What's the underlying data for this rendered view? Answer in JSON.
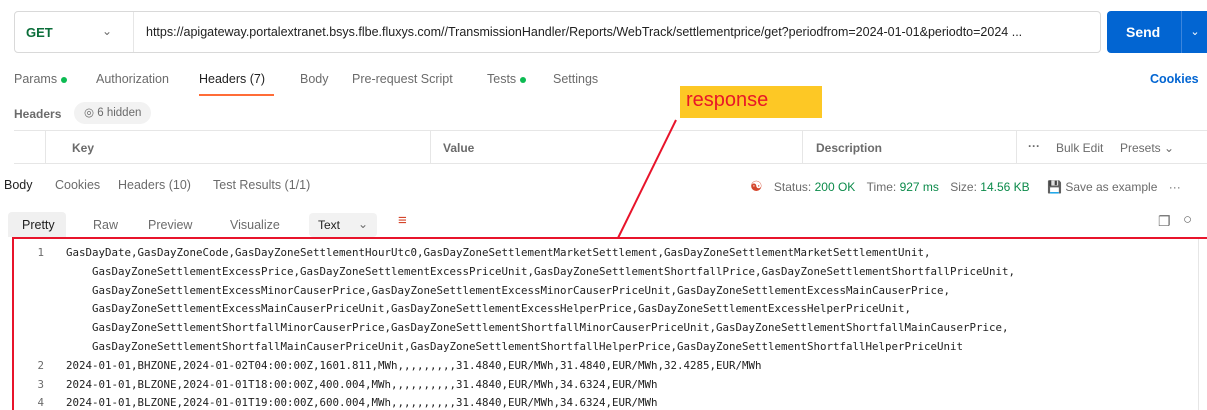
{
  "request": {
    "method": "GET",
    "url": "https://apigateway.portalextranet.bsys.flbe.fluxys.com//TransmissionHandler/Reports/WebTrack/settlementprice/get?periodfrom=2024-01-01&periodto=2024 ...",
    "send_label": "Send"
  },
  "request_tabs": [
    "Params",
    "Authorization",
    "Headers (7)",
    "Body",
    "Pre-request Script",
    "Tests",
    "Settings"
  ],
  "cookies_label": "Cookies",
  "headers_section": {
    "title": "Headers",
    "hidden": "6 hidden"
  },
  "table": {
    "col_key": "Key",
    "col_value": "Value",
    "col_description": "Description",
    "bulk_edit": "Bulk Edit",
    "presets": "Presets"
  },
  "response_tabs": [
    "Body",
    "Cookies",
    "Headers (10)",
    "Test Results (1/1)"
  ],
  "status": {
    "status_label": "Status:",
    "status_value": "200 OK",
    "time_label": "Time:",
    "time_value": "927 ms",
    "size_label": "Size:",
    "size_value": "14.56 KB",
    "save_example": "Save as example"
  },
  "view_tabs": [
    "Pretty",
    "Raw",
    "Preview",
    "Visualize"
  ],
  "format_select": "Text",
  "annotation": "response",
  "code_lines": [
    {
      "n": "1",
      "t": "GasDayDate,GasDayZoneCode,GasDayZoneSettlementHourUtc0,GasDayZoneSettlementMarketSettlement,GasDayZoneSettlementMarketSettlementUnit,"
    },
    {
      "n": "",
      "t": "    GasDayZoneSettlementExcessPrice,GasDayZoneSettlementExcessPriceUnit,GasDayZoneSettlementShortfallPrice,GasDayZoneSettlementShortfallPriceUnit,"
    },
    {
      "n": "",
      "t": "    GasDayZoneSettlementExcessMinorCauserPrice,GasDayZoneSettlementExcessMinorCauserPriceUnit,GasDayZoneSettlementExcessMainCauserPrice,"
    },
    {
      "n": "",
      "t": "    GasDayZoneSettlementExcessMainCauserPriceUnit,GasDayZoneSettlementExcessHelperPrice,GasDayZoneSettlementExcessHelperPriceUnit,"
    },
    {
      "n": "",
      "t": "    GasDayZoneSettlementShortfallMinorCauserPrice,GasDayZoneSettlementShortfallMinorCauserPriceUnit,GasDayZoneSettlementShortfallMainCauserPrice,"
    },
    {
      "n": "",
      "t": "    GasDayZoneSettlementShortfallMainCauserPriceUnit,GasDayZoneSettlementShortfallHelperPrice,GasDayZoneSettlementShortfallHelperPriceUnit"
    },
    {
      "n": "2",
      "t": "2024-01-01,BHZONE,2024-01-02T04:00:00Z,1601.811,MWh,,,,,,,,,31.4840,EUR/MWh,31.4840,EUR/MWh,32.4285,EUR/MWh"
    },
    {
      "n": "3",
      "t": "2024-01-01,BLZONE,2024-01-01T18:00:00Z,400.004,MWh,,,,,,,,,,31.4840,EUR/MWh,34.6324,EUR/MWh"
    },
    {
      "n": "4",
      "t": "2024-01-01,BLZONE,2024-01-01T19:00:00Z,600.004,MWh,,,,,,,,,,31.4840,EUR/MWh,34.6324,EUR/MWh"
    }
  ],
  "colors": {
    "accent": "#ff6c37",
    "send": "#0265d2",
    "highlight_border": "#e8142b",
    "annotation_bg": "#fdc825",
    "ok": "#0b8a4a"
  }
}
